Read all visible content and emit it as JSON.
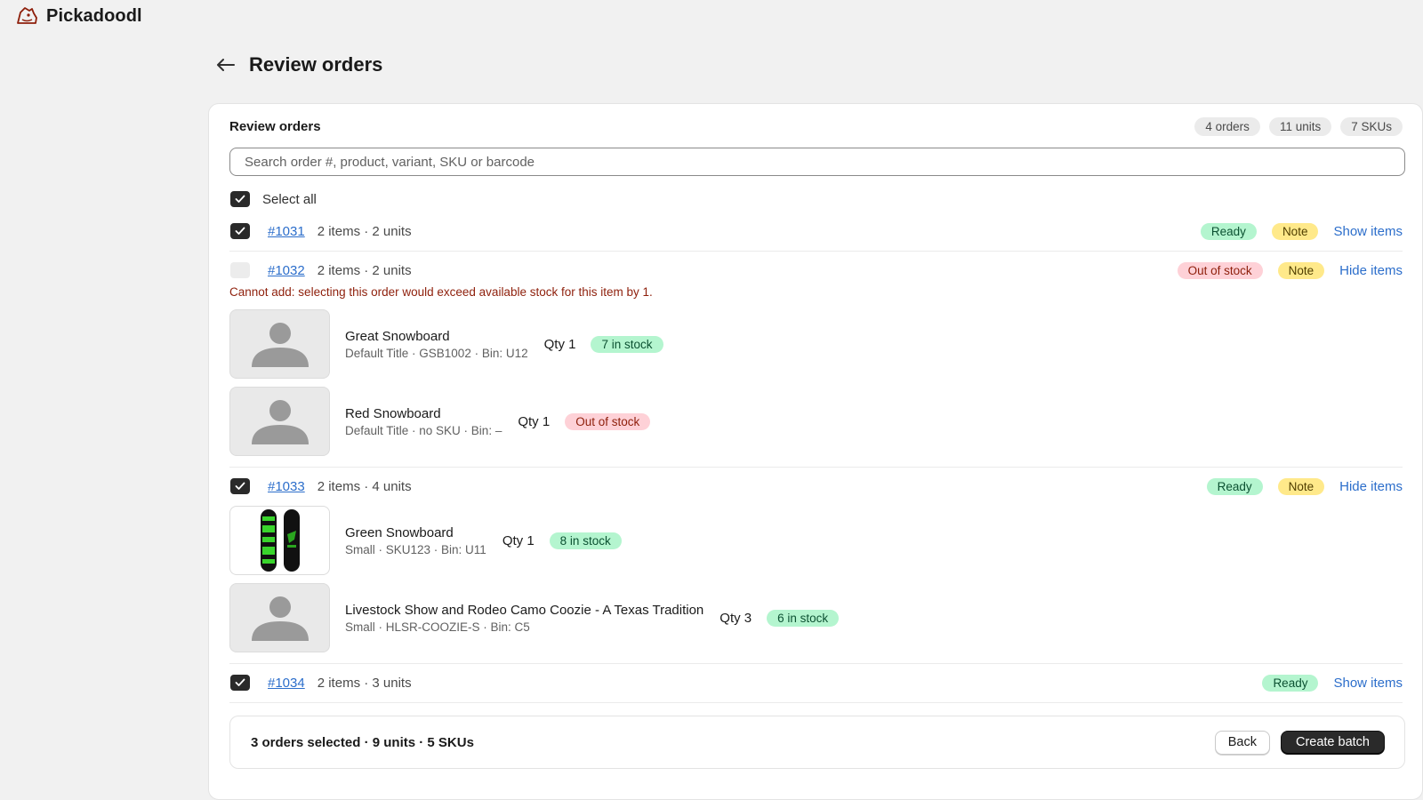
{
  "app": {
    "brand": "Pickadoodl",
    "logo_icon": "doodle-dog-logo-icon",
    "accent_color": "#2c6ecb"
  },
  "page": {
    "title": "Review orders",
    "back_icon": "arrow-left-icon"
  },
  "card": {
    "title": "Review orders",
    "pills": {
      "orders": "4 orders",
      "units": "11 units",
      "skus": "7 SKUs"
    }
  },
  "search": {
    "placeholder": "Search order #, product, variant, SKU or barcode",
    "value": ""
  },
  "select_all": {
    "label": "Select all",
    "checked": true
  },
  "orders": [
    {
      "number": "#1031",
      "meta": "2 items · 2 units",
      "checked": true,
      "status": "Ready",
      "note": "Note",
      "toggle": "Show items"
    },
    {
      "number": "#1032",
      "meta": "2 items · 2 units",
      "checked": false,
      "status": "Out of stock",
      "note": "Note",
      "toggle": "Hide items",
      "error": "Cannot add: selecting this order would exceed available stock for this item by 1.",
      "items": [
        {
          "name": "Great Snowboard",
          "sub": "Default Title · GSB1002 · Bin: U12",
          "qty": "Qty 1",
          "stock": "7 in stock",
          "stock_state": "in",
          "image": "placeholder-person-icon"
        },
        {
          "name": "Red Snowboard",
          "sub": "Default Title · no SKU · Bin: –",
          "qty": "Qty 1",
          "stock": "Out of stock",
          "stock_state": "out",
          "image": "placeholder-person-icon"
        }
      ]
    },
    {
      "number": "#1033",
      "meta": "2 items · 4 units",
      "checked": true,
      "status": "Ready",
      "note": "Note",
      "toggle": "Hide items",
      "items": [
        {
          "name": "Green Snowboard",
          "sub": "Small · SKU123 · Bin: U11",
          "qty": "Qty 1",
          "stock": "8 in stock",
          "stock_state": "in",
          "image": "green-snowboard-photo"
        },
        {
          "name": "Livestock Show and Rodeo Camo Coozie - A Texas Tradition",
          "sub": "Small · HLSR-COOZIE-S · Bin: C5",
          "qty": "Qty 3",
          "stock": "6 in stock",
          "stock_state": "in",
          "image": "placeholder-person-icon"
        }
      ]
    },
    {
      "number": "#1034",
      "meta": "2 items · 3 units",
      "checked": true,
      "status": "Ready",
      "toggle": "Show items"
    }
  ],
  "footer": {
    "summary": "3 orders selected · 9 units · 5 SKUs",
    "back_label": "Back",
    "create_label": "Create batch"
  }
}
